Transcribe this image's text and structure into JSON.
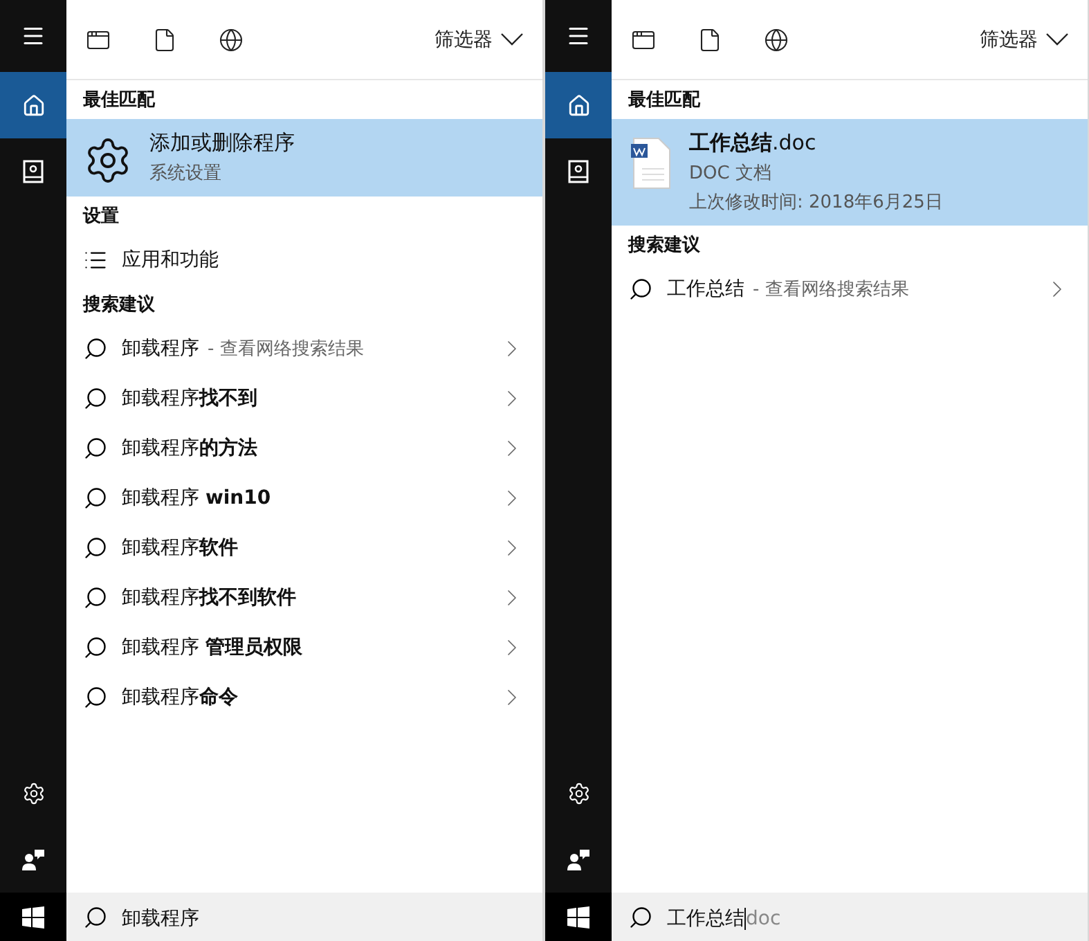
{
  "panels": [
    {
      "nav": [
        {
          "kind": "home",
          "selected": true
        },
        {
          "kind": "notebook",
          "selected": false
        }
      ],
      "filter": "筛选器",
      "sections": [
        {
          "kind": "best",
          "heading": "最佳匹配",
          "item": {
            "kind": "settings",
            "title": "添加或删除程序",
            "lines": [
              "系统设置"
            ],
            "selected": true
          }
        },
        {
          "kind": "list",
          "heading": "设置",
          "items": [
            {
              "kind": "list",
              "text": "应用和功能"
            }
          ]
        },
        {
          "kind": "suggestions",
          "heading": "搜索建议",
          "items": [
            {
              "text": "卸载程序",
              "hint": "- 查看网络搜索结果"
            },
            {
              "text": "卸载程序**找不到**"
            },
            {
              "text": "卸载程序**的方法**"
            },
            {
              "text": "卸载程序 **win10**"
            },
            {
              "text": "卸载程序**软件**"
            },
            {
              "text": "卸载程序**找不到软件**"
            },
            {
              "text": "卸载程序 **管理员权限**"
            },
            {
              "text": "卸载程序**命令**"
            }
          ]
        }
      ],
      "search": {
        "value": "卸载程序"
      }
    },
    {
      "nav": [
        {
          "kind": "home",
          "selected": true
        },
        {
          "kind": "notebook",
          "selected": false
        }
      ],
      "filter": "筛选器",
      "sections": [
        {
          "kind": "best",
          "heading": "最佳匹配",
          "item": {
            "kind": "document",
            "title": "**工作总结**.doc",
            "lines": [
              "DOC 文档",
              "上次修改时间: 2018年6月25日"
            ],
            "selected": true
          }
        },
        {
          "kind": "suggestions",
          "heading": "搜索建议",
          "items": [
            {
              "text": "工作总结",
              "hint": "- 查看网络搜索结果"
            }
          ]
        }
      ],
      "search": {
        "value": "工作总结",
        "completion": "doc"
      }
    }
  ]
}
